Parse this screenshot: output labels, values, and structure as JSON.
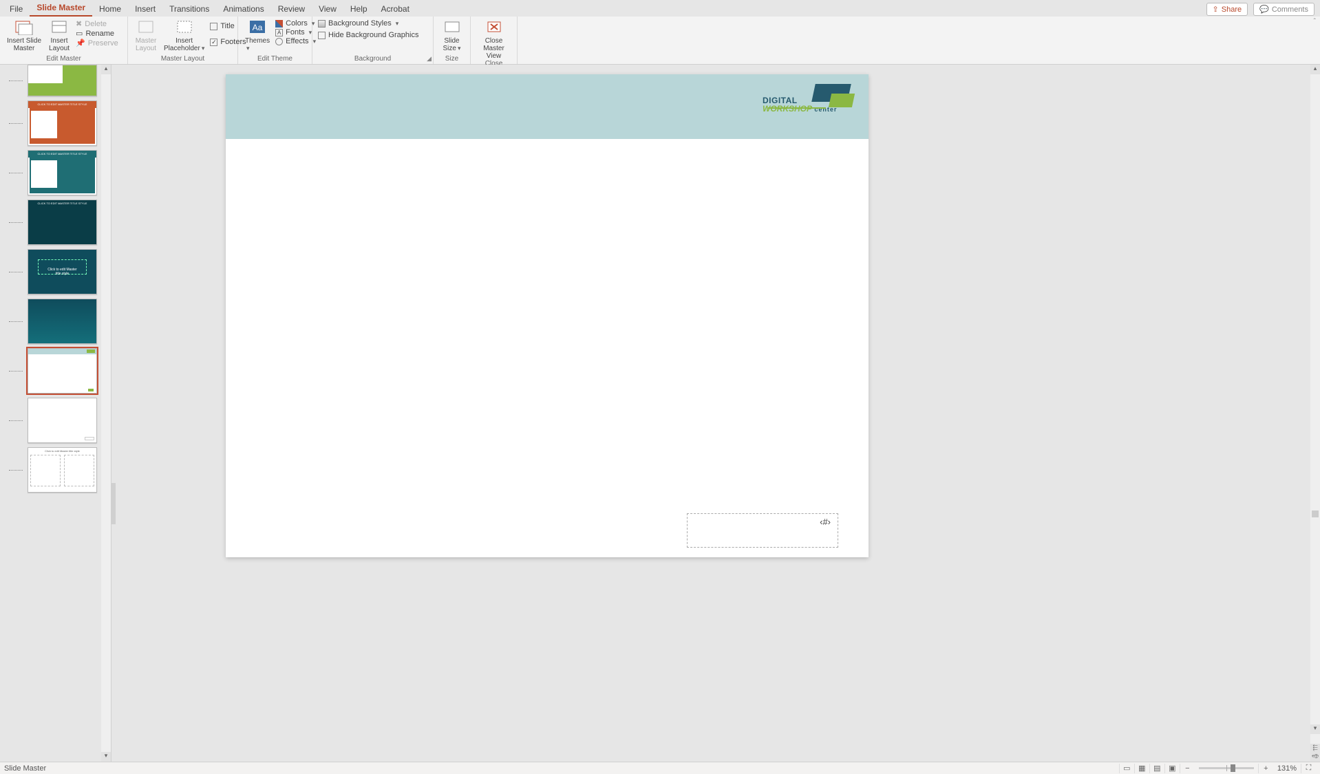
{
  "tabs": {
    "file": "File",
    "slide_master": "Slide Master",
    "home": "Home",
    "insert": "Insert",
    "transitions": "Transitions",
    "animations": "Animations",
    "review": "Review",
    "view": "View",
    "help": "Help",
    "acrobat": "Acrobat"
  },
  "titlebar": {
    "share": "Share",
    "comments": "Comments"
  },
  "ribbon": {
    "edit_master": {
      "insert_slide_master": "Insert Slide\nMaster",
      "insert_layout": "Insert\nLayout",
      "delete": "Delete",
      "rename": "Rename",
      "preserve": "Preserve",
      "label": "Edit Master"
    },
    "master_layout": {
      "master_layout": "Master\nLayout",
      "insert_placeholder": "Insert\nPlaceholder",
      "title_chk": "Title",
      "footers_chk": "Footers",
      "label": "Master Layout"
    },
    "edit_theme": {
      "themes": "Themes",
      "colors": "Colors",
      "fonts": "Fonts",
      "effects": "Effects",
      "label": "Edit Theme"
    },
    "background": {
      "bg_styles": "Background Styles",
      "hide_bg": "Hide Background Graphics",
      "label": "Background"
    },
    "size": {
      "slide_size": "Slide\nSize",
      "label": "Size"
    },
    "close": {
      "close_master": "Close\nMaster View",
      "label": "Close"
    }
  },
  "slide": {
    "logo_l1": "DIGITAL",
    "logo_l2": "WORKSHOP",
    "logo_l3": "center",
    "page_num_placeholder": "‹#›"
  },
  "thumbs": {
    "t2": "CLICK TO EDIT MASTER TITLE STYLE",
    "t3": "CLICK TO EDIT MASTER TITLE STYLE",
    "t4": "CLICK TO EDIT MASTER TITLE STYLE",
    "t5": "Click to edit Master\ntitle style",
    "t9": "Click to edit Master title style"
  },
  "status": {
    "mode": "Slide Master",
    "zoom": "131%"
  }
}
